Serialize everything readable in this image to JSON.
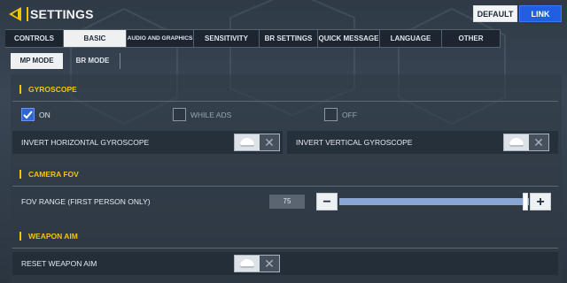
{
  "header": {
    "title": "SETTINGS",
    "default_label": "DEFAULT",
    "link_label": "LINK"
  },
  "tabs": [
    {
      "label": "CONTROLS",
      "active": false
    },
    {
      "label": "BASIC",
      "active": true
    },
    {
      "label": "AUDIO AND GRAPHICS",
      "active": false
    },
    {
      "label": "SENSITIVITY",
      "active": false
    },
    {
      "label": "BR SETTINGS",
      "active": false
    },
    {
      "label": "QUICK MESSAGE",
      "active": false
    },
    {
      "label": "LANGUAGE",
      "active": false
    },
    {
      "label": "OTHER",
      "active": false
    }
  ],
  "subtabs": [
    {
      "label": "MP MODE",
      "active": true
    },
    {
      "label": "BR MODE",
      "active": false
    }
  ],
  "gyroscope": {
    "heading": "GYROSCOPE",
    "options": [
      {
        "label": "ON",
        "checked": true
      },
      {
        "label": "WHILE ADS",
        "checked": false
      },
      {
        "label": "OFF",
        "checked": false
      }
    ],
    "invert_horizontal_label": "INVERT HORIZONTAL GYROSCOPE",
    "invert_vertical_label": "INVERT VERTICAL GYROSCOPE"
  },
  "camera_fov": {
    "heading": "CAMERA FOV",
    "range_label": "FOV RANGE (FIRST PERSON ONLY)",
    "value": "75",
    "fill_fraction": 0.98,
    "minus": "−",
    "plus": "+"
  },
  "weapon_aim": {
    "heading": "WEAPON AIM",
    "reset_label": "RESET WEAPON AIM"
  },
  "colors": {
    "accent_yellow": "#f6c400",
    "link_blue": "#1f5fe0",
    "check_blue": "#2f66d6"
  }
}
